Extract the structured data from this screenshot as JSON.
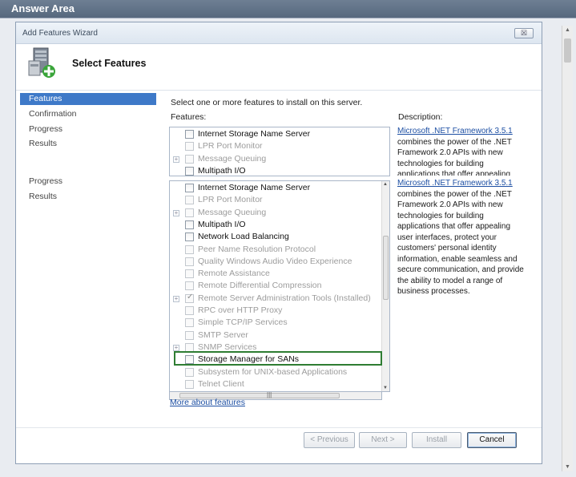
{
  "answer_area": {
    "title": "Answer Area"
  },
  "wizard": {
    "title": "Add Features Wizard",
    "close_label": "☒",
    "header_title": "Select Features",
    "nav": [
      {
        "label": "Features",
        "active": true
      },
      {
        "label": "Confirmation",
        "active": false
      },
      {
        "label": "Progress",
        "active": false
      },
      {
        "label": "Results",
        "active": false
      },
      {
        "label": "Progress",
        "active": false
      },
      {
        "label": "Results",
        "active": false
      }
    ],
    "intro": "Select one or more features to install on this server.",
    "features_label": "Features:",
    "list_top": [
      {
        "label": "Internet Storage Name Server",
        "enabled": true,
        "checked": false,
        "expander": false
      },
      {
        "label": "LPR Port Monitor",
        "enabled": false,
        "checked": false,
        "expander": false
      },
      {
        "label": "Message Queuing",
        "enabled": false,
        "checked": false,
        "expander": true
      },
      {
        "label": "Multipath I/O",
        "enabled": true,
        "checked": false,
        "expander": false
      }
    ],
    "list_main": [
      {
        "label": "Internet Storage Name Server",
        "enabled": true,
        "checked": false,
        "expander": false
      },
      {
        "label": "LPR Port Monitor",
        "enabled": false,
        "checked": false,
        "expander": false
      },
      {
        "label": "Message Queuing",
        "enabled": false,
        "checked": false,
        "expander": true
      },
      {
        "label": "Multipath I/O",
        "enabled": true,
        "checked": false,
        "expander": false
      },
      {
        "label": "Network Load Balancing",
        "enabled": true,
        "checked": false,
        "expander": false
      },
      {
        "label": "Peer Name Resolution Protocol",
        "enabled": false,
        "checked": false,
        "expander": false
      },
      {
        "label": "Quality Windows Audio Video Experience",
        "enabled": false,
        "checked": false,
        "expander": false
      },
      {
        "label": "Remote Assistance",
        "enabled": false,
        "checked": false,
        "expander": false
      },
      {
        "label": "Remote Differential Compression",
        "enabled": false,
        "checked": false,
        "expander": false
      },
      {
        "label": "Remote Server Administration Tools  (Installed)",
        "enabled": false,
        "checked": true,
        "expander": true
      },
      {
        "label": "RPC over HTTP Proxy",
        "enabled": false,
        "checked": false,
        "expander": false
      },
      {
        "label": "Simple TCP/IP Services",
        "enabled": false,
        "checked": false,
        "expander": false
      },
      {
        "label": "SMTP Server",
        "enabled": false,
        "checked": false,
        "expander": false
      },
      {
        "label": "SNMP Services",
        "enabled": false,
        "checked": false,
        "expander": true
      },
      {
        "label": "Storage Manager for SANs",
        "enabled": true,
        "checked": false,
        "expander": false
      },
      {
        "label": "Subsystem for UNIX-based Applications",
        "enabled": false,
        "checked": false,
        "expander": false
      },
      {
        "label": "Telnet Client",
        "enabled": false,
        "checked": false,
        "expander": false
      }
    ],
    "more_link": "More about features",
    "description_label": "Description:",
    "description": {
      "link": "Microsoft .NET Framework 3.5.1",
      "text": "combines the power of the .NET Framework 2.0 APIs with new technologies for building applications that offer appealing user interfaces, protect your customers' personal identity information, enable seamless and secure communication, and provide the ability to model a range of business processes."
    },
    "buttons": {
      "previous": "< Previous",
      "next": "Next >",
      "install": "Install",
      "cancel": "Cancel"
    }
  }
}
